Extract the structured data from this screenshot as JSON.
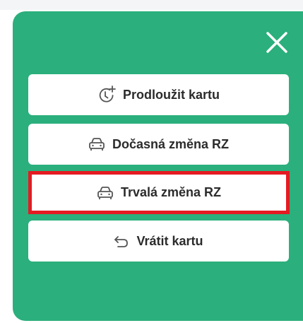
{
  "dialog": {
    "close_label": "×",
    "actions": [
      {
        "id": "extend",
        "label": "Prodloužit kartu",
        "icon": "clock-plus-icon"
      },
      {
        "id": "temporary",
        "label": "Dočasná změna RZ",
        "icon": "car-icon"
      },
      {
        "id": "permanent",
        "label": "Trvalá změna RZ",
        "icon": "car-icon",
        "highlighted": true
      },
      {
        "id": "return",
        "label": "Vrátit kartu",
        "icon": "undo-arrow-icon"
      }
    ]
  },
  "colors": {
    "panel": "#2baf7c",
    "button_bg": "#ffffff",
    "text": "#2b2b2b",
    "highlight_border": "#e41b23"
  }
}
